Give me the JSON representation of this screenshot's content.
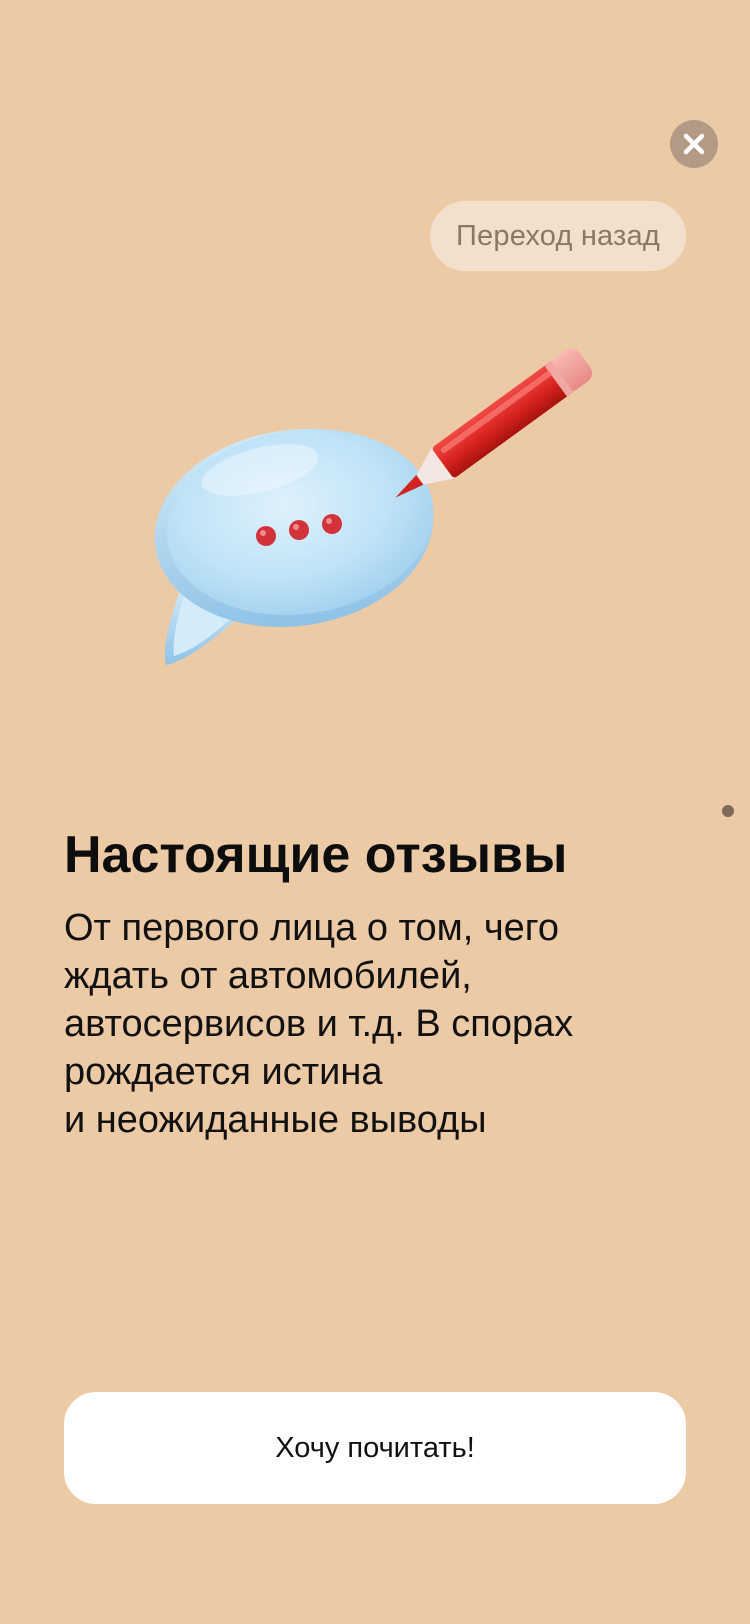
{
  "screen": {
    "background_color": "#edcaa6"
  },
  "close_button": {
    "icon": "close-icon"
  },
  "back_pill": {
    "label": "Переход назад"
  },
  "illustration": {
    "icons": [
      "speech-bubble-icon",
      "pencil-icon"
    ]
  },
  "content": {
    "title": "Настоящие отзывы",
    "description_lines": [
      "От первого лица о том, чего",
      "ждать от автомобилей,",
      "автосервисов и т.д. В спорах",
      "рождается истина",
      "и неожиданные выводы"
    ]
  },
  "cta": {
    "label": "Хочу почитать!"
  }
}
